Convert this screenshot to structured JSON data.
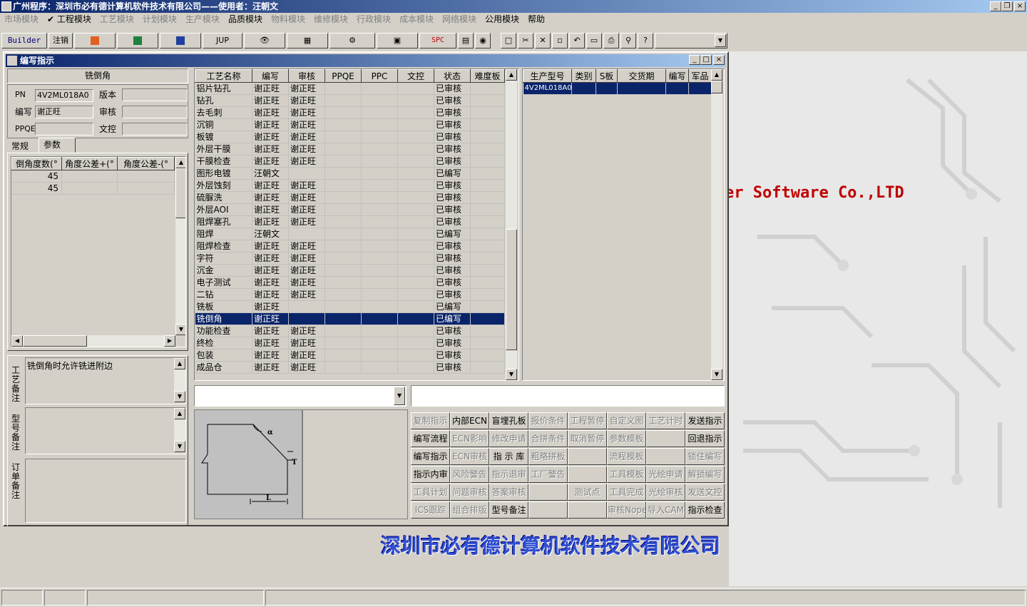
{
  "app_title": "广州程序：深圳市必有德计算机软件技术有限公司——使用者：汪朝文",
  "menu": [
    {
      "label": "市场模块",
      "enabled": false
    },
    {
      "label": "✔ 工程模块",
      "enabled": true
    },
    {
      "label": "工艺模块",
      "enabled": false
    },
    {
      "label": "计划模块",
      "enabled": false
    },
    {
      "label": "生产模块",
      "enabled": false
    },
    {
      "label": "品质模块",
      "enabled": true
    },
    {
      "label": "物料模块",
      "enabled": false
    },
    {
      "label": "维修模块",
      "enabled": false
    },
    {
      "label": "行政模块",
      "enabled": false
    },
    {
      "label": "成本模块",
      "enabled": false
    },
    {
      "label": "网络模块",
      "enabled": false
    },
    {
      "label": "公用模块",
      "enabled": true
    },
    {
      "label": "帮助",
      "enabled": true
    }
  ],
  "toolbar": {
    "builder": "Builder",
    "logout": "注销",
    "jup": "JUP",
    "spc": "SPC"
  },
  "window_title": "编写指示",
  "left": {
    "proc_name": "铣倒角",
    "pn_label": "PN",
    "pn_value": "4V2ML018A0",
    "version_label": "版本",
    "version_value": "",
    "author_label": "编写",
    "author_value": "谢正旺",
    "review_label": "审核",
    "review_value": "",
    "ppqe_label": "PPQE",
    "ppqe_value": "",
    "doc_label": "文控",
    "doc_value": "",
    "tabs": [
      "常规",
      "参数"
    ],
    "param_headers": [
      "倒角度数(°",
      "角度公差+(°",
      "角度公差-(°"
    ],
    "param_rows": [
      [
        "45",
        "",
        ""
      ],
      [
        "45",
        "",
        ""
      ]
    ],
    "note_proc_label": "工艺备注",
    "note_proc_value": "铣倒角时允许铣进附边",
    "note_model_label": "型号备注",
    "note_order_label": "订单备注"
  },
  "process_table": {
    "headers": [
      "工艺名称",
      "编写",
      "审核",
      "PPQE",
      "PPC",
      "文控",
      "状态",
      "难度板"
    ],
    "selected": 19,
    "rows": [
      [
        "铝片钻孔",
        "谢正旺",
        "谢正旺",
        "",
        "",
        "",
        "已审核",
        ""
      ],
      [
        "钻孔",
        "谢正旺",
        "谢正旺",
        "",
        "",
        "",
        "已审核",
        ""
      ],
      [
        "去毛刺",
        "谢正旺",
        "谢正旺",
        "",
        "",
        "",
        "已审核",
        ""
      ],
      [
        "沉铜",
        "谢正旺",
        "谢正旺",
        "",
        "",
        "",
        "已审核",
        ""
      ],
      [
        "板镀",
        "谢正旺",
        "谢正旺",
        "",
        "",
        "",
        "已审核",
        ""
      ],
      [
        "外层干膜",
        "谢正旺",
        "谢正旺",
        "",
        "",
        "",
        "已审核",
        ""
      ],
      [
        "干膜检查",
        "谢正旺",
        "谢正旺",
        "",
        "",
        "",
        "已审核",
        ""
      ],
      [
        "图形电镀",
        "汪朝文",
        "",
        "",
        "",
        "",
        "已编写",
        ""
      ],
      [
        "外层蚀刻",
        "谢正旺",
        "谢正旺",
        "",
        "",
        "",
        "已审核",
        ""
      ],
      [
        "硫脲洗",
        "谢正旺",
        "谢正旺",
        "",
        "",
        "",
        "已审核",
        ""
      ],
      [
        "外层AOI",
        "谢正旺",
        "谢正旺",
        "",
        "",
        "",
        "已审核",
        ""
      ],
      [
        "阻焊塞孔",
        "谢正旺",
        "谢正旺",
        "",
        "",
        "",
        "已审核",
        ""
      ],
      [
        "阻焊",
        "汪朝文",
        "",
        "",
        "",
        "",
        "已编写",
        ""
      ],
      [
        "阻焊检查",
        "谢正旺",
        "谢正旺",
        "",
        "",
        "",
        "已审核",
        ""
      ],
      [
        "字符",
        "谢正旺",
        "谢正旺",
        "",
        "",
        "",
        "已审核",
        ""
      ],
      [
        "沉金",
        "谢正旺",
        "谢正旺",
        "",
        "",
        "",
        "已审核",
        ""
      ],
      [
        "电子测试",
        "谢正旺",
        "谢正旺",
        "",
        "",
        "",
        "已审核",
        ""
      ],
      [
        "二钻",
        "谢正旺",
        "谢正旺",
        "",
        "",
        "",
        "已审核",
        ""
      ],
      [
        "铣板",
        "谢正旺",
        "",
        "",
        "",
        "",
        "已编写",
        ""
      ],
      [
        "铣倒角",
        "谢正旺",
        "",
        "",
        "",
        "",
        "已编写",
        ""
      ],
      [
        "功能检查",
        "谢正旺",
        "谢正旺",
        "",
        "",
        "",
        "已审核",
        ""
      ],
      [
        "终检",
        "谢正旺",
        "谢正旺",
        "",
        "",
        "",
        "已审核",
        ""
      ],
      [
        "包装",
        "谢正旺",
        "谢正旺",
        "",
        "",
        "",
        "已审核",
        ""
      ],
      [
        "成品仓",
        "谢正旺",
        "谢正旺",
        "",
        "",
        "",
        "已审核",
        ""
      ]
    ]
  },
  "model_table": {
    "headers": [
      "生产型号",
      "类别",
      "S板",
      "交货期",
      "编写",
      "军品"
    ],
    "rows": [
      [
        "4V2ML018A0",
        "",
        "",
        "",
        "",
        ""
      ]
    ]
  },
  "diagram_labels": {
    "alpha": "α",
    "t": "T",
    "l": "L"
  },
  "buttons": [
    [
      {
        "label": "复制指示",
        "enabled": false
      },
      {
        "label": "内部ECN",
        "enabled": true
      },
      {
        "label": "盲埋孔板",
        "enabled": true
      },
      {
        "label": "报价条件",
        "enabled": false
      },
      {
        "label": "工程暂停",
        "enabled": false
      },
      {
        "label": "自定义图",
        "enabled": false
      },
      {
        "label": "工艺计时",
        "enabled": false
      },
      {
        "label": "发送指示",
        "enabled": true
      }
    ],
    [
      {
        "label": "编写流程",
        "enabled": true
      },
      {
        "label": "ECN影响",
        "enabled": false
      },
      {
        "label": "修改申请",
        "enabled": false
      },
      {
        "label": "合拼条件",
        "enabled": false
      },
      {
        "label": "取消暂停",
        "enabled": false
      },
      {
        "label": "参数模板",
        "enabled": false
      },
      {
        "label": "",
        "enabled": false
      },
      {
        "label": "回退指示",
        "enabled": true
      }
    ],
    [
      {
        "label": "编写指示",
        "enabled": true
      },
      {
        "label": "ECN审核",
        "enabled": false
      },
      {
        "label": "指 示 库",
        "enabled": true
      },
      {
        "label": "粗略拼板",
        "enabled": false
      },
      {
        "label": "",
        "enabled": false
      },
      {
        "label": "流程模板",
        "enabled": false
      },
      {
        "label": "",
        "enabled": false
      },
      {
        "label": "锁住编写",
        "enabled": false
      }
    ],
    [
      {
        "label": "指示内审",
        "enabled": true
      },
      {
        "label": "风险警告",
        "enabled": false
      },
      {
        "label": "指示退审",
        "enabled": false
      },
      {
        "label": "工厂警告",
        "enabled": false
      },
      {
        "label": "",
        "enabled": false
      },
      {
        "label": "工具模板",
        "enabled": false
      },
      {
        "label": "光绘申请",
        "enabled": false
      },
      {
        "label": "解锁编写",
        "enabled": false
      }
    ],
    [
      {
        "label": "工具计划",
        "enabled": false
      },
      {
        "label": "问题审核",
        "enabled": false
      },
      {
        "label": "答案审核",
        "enabled": false
      },
      {
        "label": "",
        "enabled": false
      },
      {
        "label": "测试点",
        "enabled": false
      },
      {
        "label": "工具完成",
        "enabled": false
      },
      {
        "label": "光绘审核",
        "enabled": false
      },
      {
        "label": "发送文控",
        "enabled": false
      }
    ],
    [
      {
        "label": "ICS跟踪",
        "enabled": false
      },
      {
        "label": "组合排版",
        "enabled": false
      },
      {
        "label": "型号备注",
        "enabled": true
      },
      {
        "label": "",
        "enabled": false
      },
      {
        "label": "",
        "enabled": false
      },
      {
        "label": "审核Nope",
        "enabled": false
      },
      {
        "label": "导入CAM",
        "enabled": false
      },
      {
        "label": "指示检查",
        "enabled": true
      }
    ]
  ],
  "background": {
    "brand_en": "er Software Co.,LTD",
    "brand_cn": "深圳市必有德计算机软件技术有限公司"
  },
  "colors": {
    "title": "#0a246a",
    "selection": "#0a246a",
    "brand_en": "#c00000",
    "brand_cn": "#3050d0"
  }
}
